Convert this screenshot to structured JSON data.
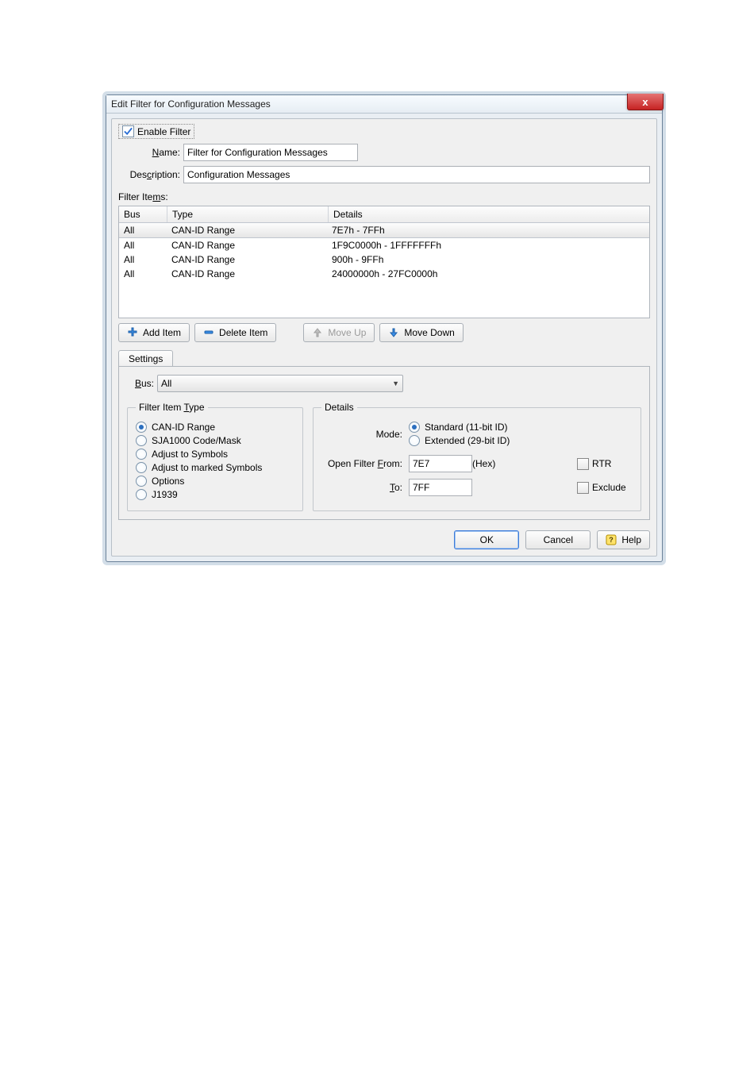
{
  "window": {
    "title": "Edit Filter for Configuration Messages",
    "close_x": "x"
  },
  "enable": {
    "label": "Enable Filter",
    "checked": true
  },
  "labels": {
    "name": "Name:",
    "name_u": "N",
    "description": "Description:",
    "description_u": "c",
    "filter_items": "Filter Items:",
    "filter_items_u": "m",
    "bus": "Bus:",
    "bus_u": "B",
    "filter_item_type": "Filter Item Type",
    "filter_item_type_u": "T",
    "details": "Details",
    "mode": "Mode:",
    "from": "Open Filter From:",
    "from_u": "F",
    "to": "To:",
    "to_u": "T",
    "hex": "(Hex)"
  },
  "fields": {
    "name": "Filter for Configuration Messages",
    "description": "Configuration Messages",
    "bus_value": "All",
    "from": "7E7",
    "to": "7FF"
  },
  "grid": {
    "headers": {
      "bus": "Bus",
      "type": "Type",
      "details": "Details"
    },
    "rows": [
      {
        "bus": "All",
        "type": "CAN-ID Range",
        "details": "7E7h - 7FFh",
        "selected": true
      },
      {
        "bus": "All",
        "type": "CAN-ID Range",
        "details": "1F9C0000h - 1FFFFFFFh"
      },
      {
        "bus": "All",
        "type": "CAN-ID Range",
        "details": "900h - 9FFh"
      },
      {
        "bus": "All",
        "type": "CAN-ID Range",
        "details": "24000000h - 27FC0000h"
      }
    ]
  },
  "toolbar": {
    "add": "Add Item",
    "delete": "Delete Item",
    "up": "Move Up",
    "down": "Move Down"
  },
  "tab": {
    "settings": "Settings"
  },
  "filter_types": [
    {
      "label": "CAN-ID Range",
      "selected": true
    },
    {
      "label": "SJA1000 Code/Mask"
    },
    {
      "label": "Adjust to Symbols"
    },
    {
      "label": "Adjust to marked Symbols"
    },
    {
      "label": "Options"
    },
    {
      "label": "J1939"
    }
  ],
  "modes": {
    "standard": "Standard (11-bit ID)",
    "extended": "Extended (29-bit ID)",
    "selected": "standard"
  },
  "checks": {
    "rtr": "RTR",
    "exclude": "Exclude"
  },
  "footer": {
    "ok": "OK",
    "cancel": "Cancel",
    "help": "Help"
  }
}
